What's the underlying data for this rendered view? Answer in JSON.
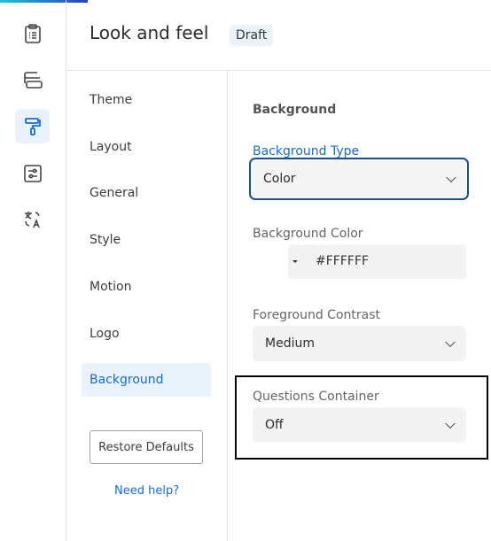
{
  "rail": {
    "items": [
      {
        "icon": "clipboard-icon"
      },
      {
        "icon": "layout-blocks-icon"
      },
      {
        "icon": "paint-roller-icon",
        "active": true
      },
      {
        "icon": "sliders-icon"
      },
      {
        "icon": "translate-icon"
      }
    ]
  },
  "header": {
    "title": "Look and feel",
    "badge": "Draft"
  },
  "nav": {
    "items": [
      "Theme",
      "Layout",
      "General",
      "Style",
      "Motion",
      "Logo",
      "Background"
    ],
    "active": "Background",
    "restore": "Restore Defaults",
    "help": "Need help?"
  },
  "panel": {
    "section": "Background",
    "bg_type": {
      "label": "Background Type",
      "value": "Color"
    },
    "bg_color": {
      "label": "Background Color",
      "value": "#FFFFFF"
    },
    "fg_contrast": {
      "label": "Foreground Contrast",
      "value": "Medium"
    },
    "questions_container": {
      "label": "Questions Container",
      "value": "Off"
    }
  },
  "colors": {
    "accent": "#1a6bd1",
    "focus_border": "#1e4e8c"
  }
}
